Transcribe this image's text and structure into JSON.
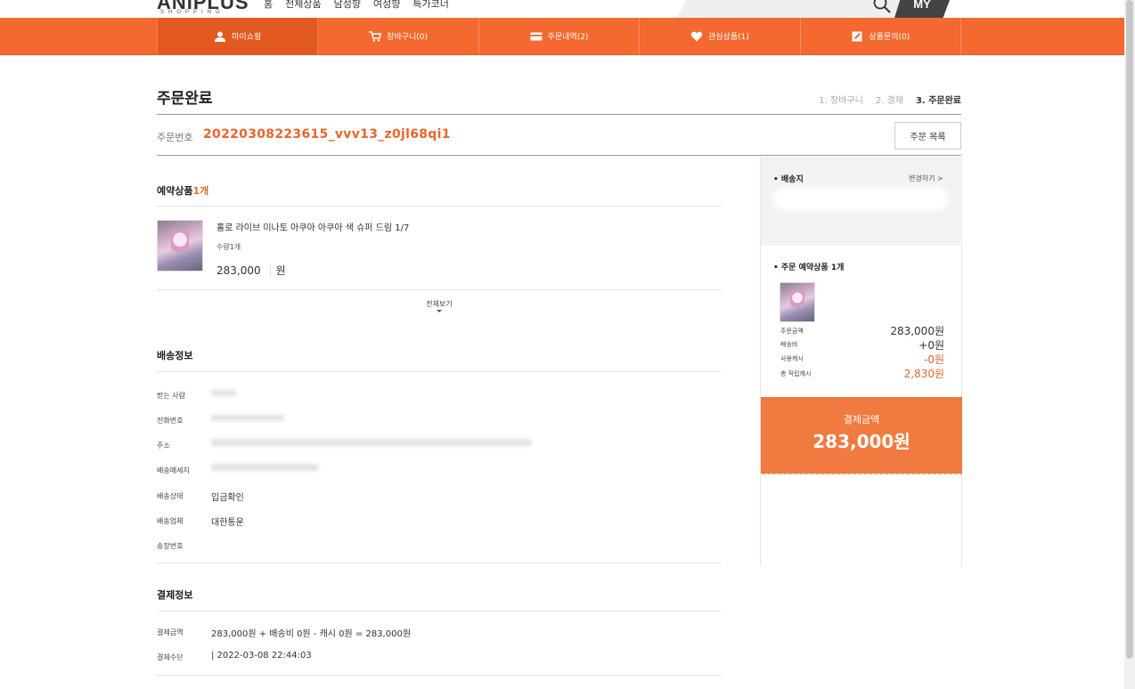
{
  "header": {
    "logo": "ANIPLUS",
    "logo_sub": "SHOPPING",
    "nav": [
      "홈",
      "전체상품",
      "남성향",
      "여성향",
      "특가코너"
    ],
    "my_label": "MY"
  },
  "tabs": [
    {
      "label": "마이쇼핑",
      "icon": "person-icon"
    },
    {
      "label": "장바구니(0)",
      "icon": "cart-icon"
    },
    {
      "label": "주문내역(2)",
      "icon": "card-icon"
    },
    {
      "label": "관심상품(1)",
      "icon": "heart-icon"
    },
    {
      "label": "상품문의(0)",
      "icon": "edit-icon"
    }
  ],
  "page": {
    "title": "주문완료",
    "steps": [
      "1. 장바구니",
      "2. 결제",
      "3. 주문완료"
    ],
    "order_label": "주문번호",
    "order_number": "20220308223615_vvv13_z0jl68qi1",
    "order_list_button": "주문 목록"
  },
  "products": {
    "section_label": "예약상품",
    "count": "1개",
    "name": "홀로 라이브 미나토 아쿠아 아쿠아 색 슈퍼 드림 1/7",
    "qty": "수량1개",
    "price": "283,000",
    "won": "원",
    "view_all": "전체보기"
  },
  "shipping_info": {
    "title": "배송정보",
    "labels": {
      "recipient": "받는 사람",
      "phone": "전화번호",
      "address": "주소",
      "message": "배송메세지",
      "status": "배송상태",
      "courier": "배송업체",
      "tracking": "송장번호"
    },
    "status": "입금확인",
    "courier": "대한통운"
  },
  "payment_info": {
    "title": "결제정보",
    "amount_label": "결제금액",
    "amount_value": "283,000원 + 배송비 0원 - 캐시 0원 = 283,000원",
    "method_label": "결제수단",
    "method_value": "| 2022-03-08 22:44:03"
  },
  "sidebar": {
    "ship_title": "• 배송지",
    "change": "변경하기 >",
    "order_title": "• 주문 예약상품 1개",
    "rows": [
      {
        "label": "주문금액",
        "value": "283,000원"
      },
      {
        "label": "배송비",
        "value": "+0원"
      },
      {
        "label": "사용캐시",
        "value": "-0원"
      },
      {
        "label": "총 적립캐시",
        "value": "2,830원"
      }
    ],
    "pay_label": "결제금액",
    "pay_amount": "283,000원"
  },
  "colors": {
    "accent": "#f4692f",
    "accent_dark": "#e2591f",
    "order_no": "#e8662e",
    "pay_box": "#f07a3f"
  }
}
